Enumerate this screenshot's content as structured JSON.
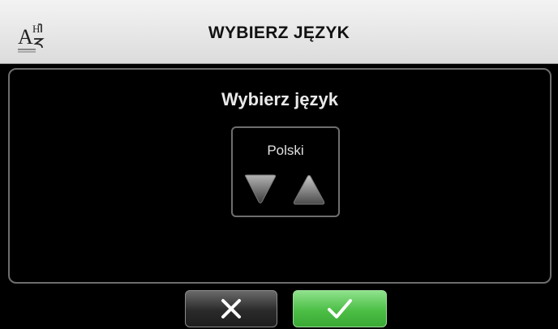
{
  "header": {
    "title": "WYBIERZ JĘZYK",
    "icon": "language-icon"
  },
  "panel": {
    "title": "Wybierz język",
    "selector": {
      "value": "Polski",
      "down_icon": "triangle-down-icon",
      "up_icon": "triangle-up-icon"
    }
  },
  "footer": {
    "cancel_icon": "close-icon",
    "confirm_icon": "checkmark-icon"
  },
  "colors": {
    "header_bg": "#e6e6e6",
    "confirm_green": "#4cbf46",
    "panel_border": "#6e6e6e"
  }
}
